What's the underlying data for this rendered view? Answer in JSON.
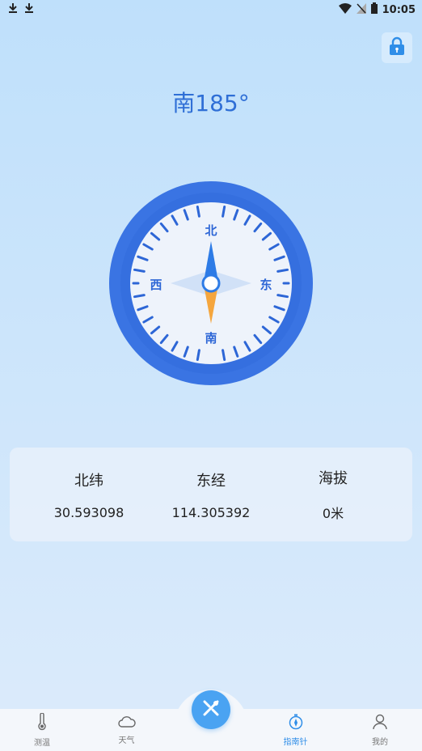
{
  "status_bar": {
    "time": "10:05",
    "left_icons": [
      "download-icon",
      "download-icon"
    ],
    "right_icons": [
      "wifi-icon",
      "signal-off-icon",
      "battery-icon"
    ]
  },
  "header": {
    "direction": "南185°",
    "lock_icon": "lock-icon"
  },
  "compass": {
    "heading_deg": 185,
    "labels": {
      "north": "北",
      "south": "南",
      "east": "东",
      "west": "西"
    },
    "colors": {
      "ring": "#3a74e3",
      "needle_north": "#2d7be6",
      "needle_south": "#f5a63e",
      "face": "#eef3fb"
    }
  },
  "info": [
    {
      "label": "北纬",
      "value": "30.593098"
    },
    {
      "label": "东经",
      "value": "114.305392"
    },
    {
      "label": "海拔",
      "value": "0米"
    }
  ],
  "tabs": [
    {
      "label": "测温",
      "icon": "thermometer-icon",
      "active": false
    },
    {
      "label": "天气",
      "icon": "cloud-icon",
      "active": false
    },
    {
      "label": "指南针",
      "icon": "compass-icon",
      "active": true
    },
    {
      "label": "我的",
      "icon": "user-icon",
      "active": false
    }
  ],
  "center_button": {
    "icon": "tools-icon"
  },
  "colors": {
    "accent": "#2f6fd6",
    "tab_active": "#2f8ee8"
  }
}
